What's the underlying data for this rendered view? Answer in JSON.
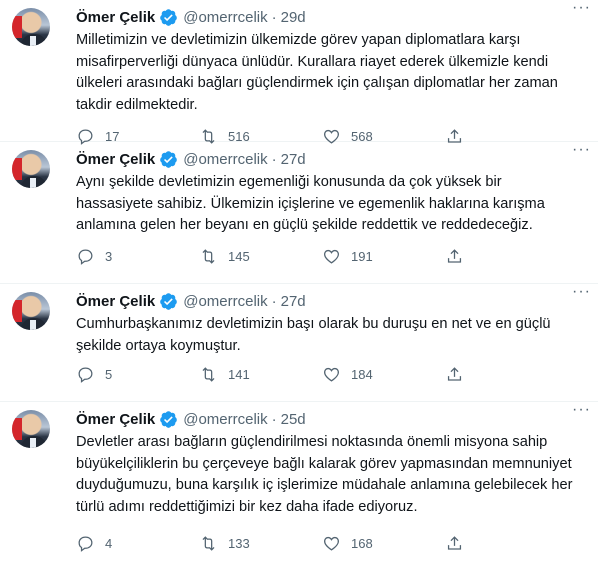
{
  "tweets": [
    {
      "name": "Ömer Çelik",
      "handle": "@omerrcelik",
      "separator": "·",
      "time": "29d",
      "text": "Milletimizin ve devletimizin ülkemizde görev yapan diplomatlara karşı misafirperverliği dünyaca ünlüdür. Kurallara riayet ederek ülkemizle kendi ülkeleri arasındaki bağları güçlendirmek için çalışan diplomatlar her zaman takdir edilmektedir.",
      "replies": "17",
      "retweets": "516",
      "likes": "568"
    },
    {
      "name": "Ömer Çelik",
      "handle": "@omerrcelik",
      "separator": "·",
      "time": "27d",
      "text": "Aynı şekilde devletimizin egemenliği konusunda da çok yüksek bir hassasiyete sahibiz. Ülkemizin içişlerine ve egemenlik haklarına karışma anlamına gelen her beyanı en güçlü şekilde reddettik ve reddedeceğiz.",
      "replies": "3",
      "retweets": "145",
      "likes": "191"
    },
    {
      "name": "Ömer Çelik",
      "handle": "@omerrcelik",
      "separator": "·",
      "time": "27d",
      "text": "Cumhurbaşkanımız devletimizin başı olarak bu duruşu en net ve en güçlü şekilde ortaya koymuştur.",
      "replies": "5",
      "retweets": "141",
      "likes": "184"
    },
    {
      "name": "Ömer Çelik",
      "handle": "@omerrcelik",
      "separator": "·",
      "time": "25d",
      "text": "Devletler arası bağların güçlendirilmesi noktasında önemli misyona sahip büyükelçiliklerin bu çerçeveye bağlı kalarak görev yapmasından memnuniyet duyduğumuzu, buna karşılık iç işlerimize müdahale anlamına gelebilecek her türlü adımı reddettiğimizi bir kez daha ifade ediyoruz.",
      "replies": "4",
      "retweets": "133",
      "likes": "168"
    }
  ],
  "icons": {
    "verified": "verified-badge-icon",
    "more": "more-dots-icon",
    "reply": "reply-icon",
    "retweet": "retweet-icon",
    "like": "like-icon",
    "share": "share-icon"
  },
  "colors": {
    "text": "#0f1419",
    "muted": "#536471",
    "verified": "#1d9bf0",
    "divider": "#eff3f4"
  }
}
